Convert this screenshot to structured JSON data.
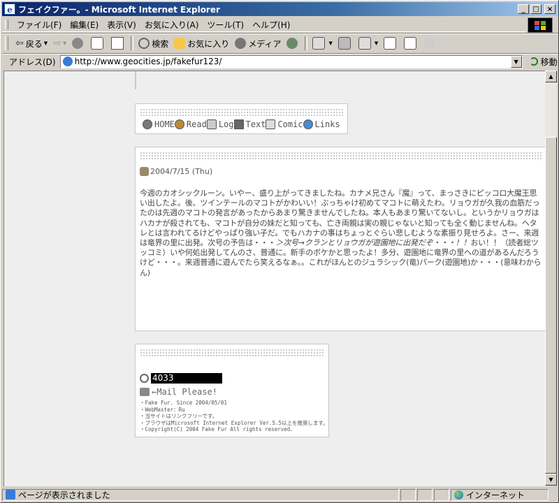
{
  "window": {
    "title": "フェイクファー。- Microsoft Internet Explorer",
    "minimize": "_",
    "maximize": "□",
    "close": "×"
  },
  "menu": {
    "items": [
      "ファイル(F)",
      "編集(E)",
      "表示(V)",
      "お気に入り(A)",
      "ツール(T)",
      "ヘルプ(H)"
    ]
  },
  "toolbar": {
    "back": "戻る",
    "search": "検索",
    "favorites": "お気に入り",
    "media": "メディア"
  },
  "address": {
    "label": "アドレス(D)",
    "url": "http://www.geocities.jp/fakefur123/",
    "go": "移動"
  },
  "page": {
    "nav": [
      "HOME",
      "Read",
      "Log",
      "Text",
      "Comic",
      "Links"
    ],
    "entry": {
      "date": "2004/7/15 (Thu)",
      "text_before": "今週のカオシックルーン。いやー、盛り上がってきましたね。カナメ兄さん『魔』って、まっさきにピッコロ大魔王思い出したよ。後、ツインテールのマコトがかわいい！ぶっちゃけ初めてマコトに萌えたわ。リョウガが久我の血筋だったのは先週のマコトの発言があったからあまり驚きませんでしたね。本人もあまり驚いてないし。というかリョウガはハカナが殺されても、マコトが自分の妹だと知っても、亡き両親は実の親じゃないと知っても全く動じませんね。ヘタレとは言われてるけどやっぱり強い子だ。でもハカナの事はちょっとぐらい悲しむような素振り見せろよ。さー、来週は竜界の里に出発。次号の予告は・・・",
      "text_italic": "＞次号→クランとリョウガが遊園地に出発だぞ・・・！！",
      "text_after": "おい！！（読者総ツッコミ）いや何処出発してんのさ、普通に。新手のボケかと思ったよ！多分、遊園地に竜界の里への道があるんだろうけど・・・。来週普通に遊んでたら笑えるなぁ。。これがほんとのジュラシック(竜)パーク(遊園地)か・・・(意味わからん)"
    },
    "counter": "4033",
    "mail": "←Mail Please!",
    "credits": [
      "・Fake Fur. Since 2004/05/01",
      "・WebMaster：Ru",
      "・当サイトはリンクフリーです。",
      "・ブラウザはMicrosoft Internet Explorer Ver.5.5以上を推奨します。",
      "・Copyright(C) 2004 Fake Fur All rights reserved."
    ]
  },
  "status": {
    "text": "ページが表示されました",
    "zone": "インターネット"
  }
}
